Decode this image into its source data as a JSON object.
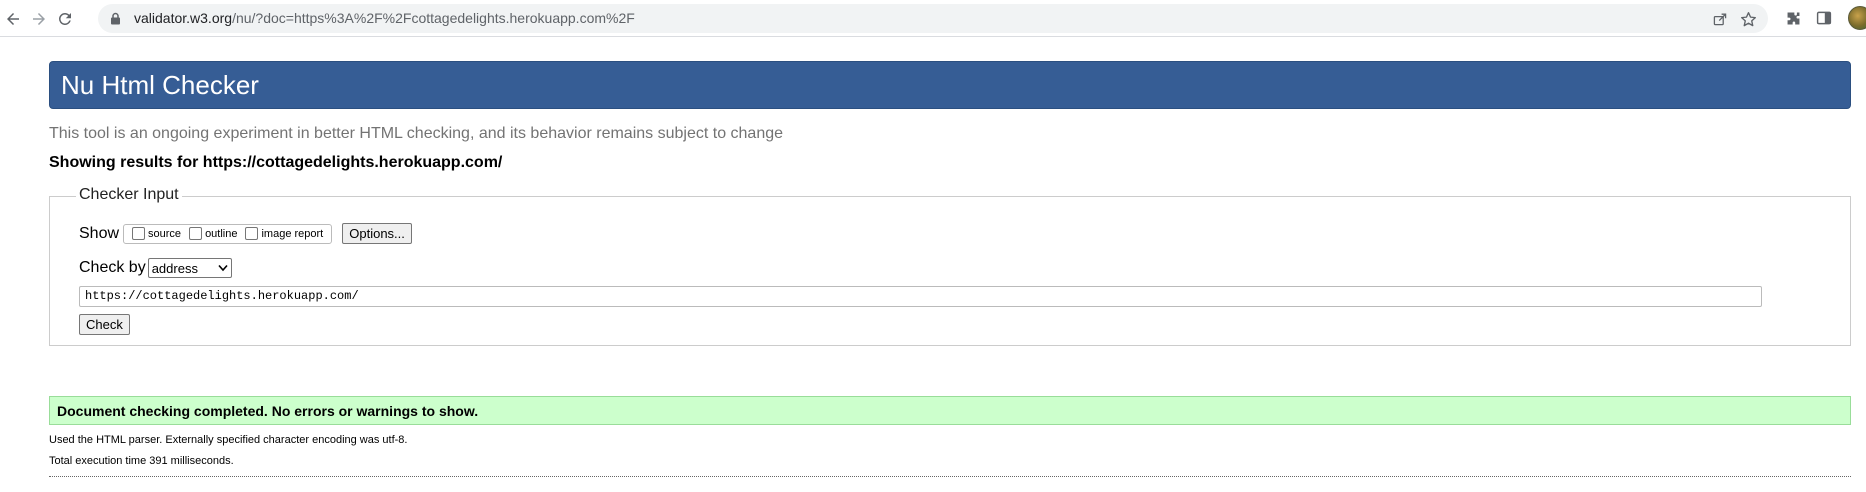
{
  "browser": {
    "url_host": "validator.w3.org",
    "url_rest": "/nu/?doc=https%3A%2F%2Fcottagedelights.herokuapp.com%2F",
    "icons": [
      "back-icon",
      "forward-icon",
      "reload-icon",
      "lock-icon",
      "share-icon",
      "star-icon",
      "extensions-icon",
      "side-panel-icon",
      "profile-avatar"
    ]
  },
  "header": {
    "title": "Nu Html Checker"
  },
  "tagline": "This tool is an ongoing experiment in better HTML checking, and its behavior remains subject to change",
  "showing_results": "Showing results for https://cottagedelights.herokuapp.com/",
  "checker_input": {
    "legend": "Checker Input",
    "show_label": "Show",
    "checkboxes": [
      {
        "label": "source",
        "checked": false
      },
      {
        "label": "outline",
        "checked": false
      },
      {
        "label": "image report",
        "checked": false
      }
    ],
    "options_button": "Options...",
    "check_by_label": "Check by",
    "check_by_selected": "address",
    "url_value": "https://cottagedelights.herokuapp.com/",
    "check_button": "Check"
  },
  "result": {
    "success_message": "Document checking completed. No errors or warnings to show.",
    "parser_info": "Used the HTML parser. Externally specified character encoding was utf-8.",
    "execution_time": "Total execution time 391 milliseconds."
  },
  "colors": {
    "title_bar": "#365d95",
    "success_bg": "#ccffcc"
  }
}
